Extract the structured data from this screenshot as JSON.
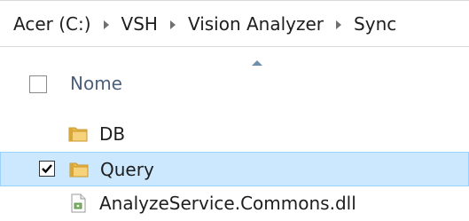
{
  "breadcrumb": {
    "items": [
      "Acer (C:)",
      "VSH",
      "Vision Analyzer",
      "Sync"
    ]
  },
  "column_header": {
    "name_label": "Nome",
    "sort": "ascending"
  },
  "items": [
    {
      "name": "DB",
      "type": "folder",
      "checked": false,
      "selected": false,
      "icon": "folder-icon"
    },
    {
      "name": "Query",
      "type": "folder",
      "checked": true,
      "selected": true,
      "icon": "folder-icon"
    },
    {
      "name": "AnalyzeService.Commons.dll",
      "type": "file",
      "checked": false,
      "selected": false,
      "icon": "dll-file-icon"
    }
  ],
  "colors": {
    "selection_bg": "#cce8ff",
    "selection_border": "#99d1ff",
    "folder": "#e8b84a",
    "header_text": "#4c607a"
  }
}
